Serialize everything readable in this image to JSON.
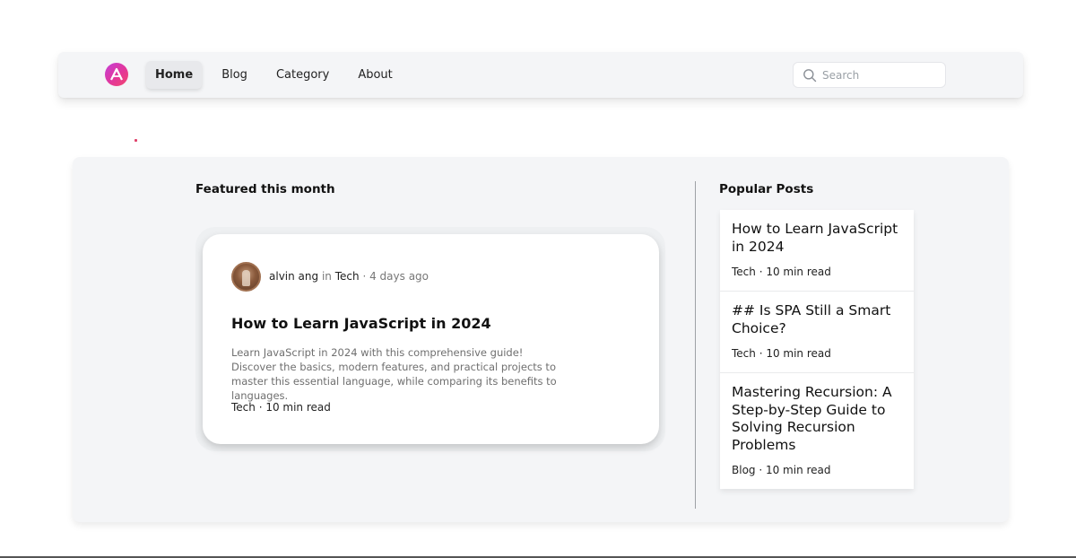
{
  "nav": {
    "links": [
      "Home",
      "Blog",
      "Category",
      "About"
    ],
    "active": "Home",
    "search_placeholder": "Search"
  },
  "featured": {
    "heading": "Featured this month",
    "author": "alvin ang",
    "in_text": "in",
    "category": "Tech",
    "separator": "·",
    "time_ago": "4 days ago",
    "title": "How to Learn JavaScript in 2024",
    "excerpt": "Learn JavaScript in 2024 with this comprehensive guide! Discover the basics, modern features, and practical projects to master this essential language, while comparing its benefits to languages.",
    "tags": "Tech · 10 min read"
  },
  "popular": {
    "heading": "Popular Posts",
    "items": [
      {
        "title": "How to Learn JavaScript in 2024",
        "meta": "Tech · 10 min read"
      },
      {
        "title": "## Is SPA Still a Smart Choice?",
        "meta": "Tech · 10 min read"
      },
      {
        "title": "Mastering Recursion: A Step-by-Step Guide to Solving Recursion Problems",
        "meta": "Blog · 10 min read"
      }
    ]
  },
  "colors": {
    "logo_gradient_start": "#c43fd8",
    "logo_gradient_end": "#f2466c",
    "panel_bg": "#f4f5f7"
  },
  "icons": {
    "logo": "logo-icon",
    "search": "search-icon",
    "avatar": "avatar-image"
  }
}
